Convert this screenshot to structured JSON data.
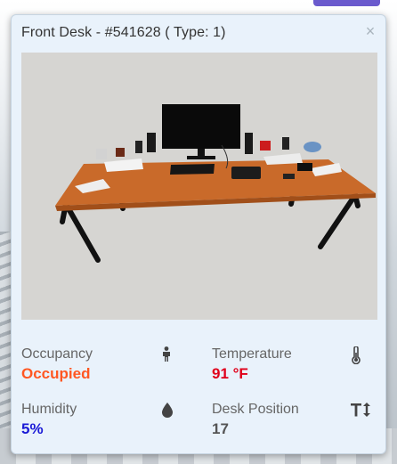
{
  "popup": {
    "title": "Front Desk - #541628 ( Type: 1)",
    "close_label": "×"
  },
  "stats": {
    "occupancy": {
      "label": "Occupancy",
      "value": "Occupied",
      "color": "#ff5722",
      "icon": "person-icon"
    },
    "temperature": {
      "label": "Temperature",
      "value": "91 °F",
      "color": "#e0001a",
      "icon": "thermometer-icon"
    },
    "humidity": {
      "label": "Humidity",
      "value": "5%",
      "color": "#1a1ad6",
      "icon": "water-drop-icon"
    },
    "desk_position": {
      "label": "Desk Position",
      "value": "17",
      "color": "#555555",
      "icon": "height-adjust-icon"
    }
  },
  "colors": {
    "popup_bg": "#e9f2fb",
    "desk_top": "#c96a2a",
    "accent_button": "#6a5acd"
  }
}
